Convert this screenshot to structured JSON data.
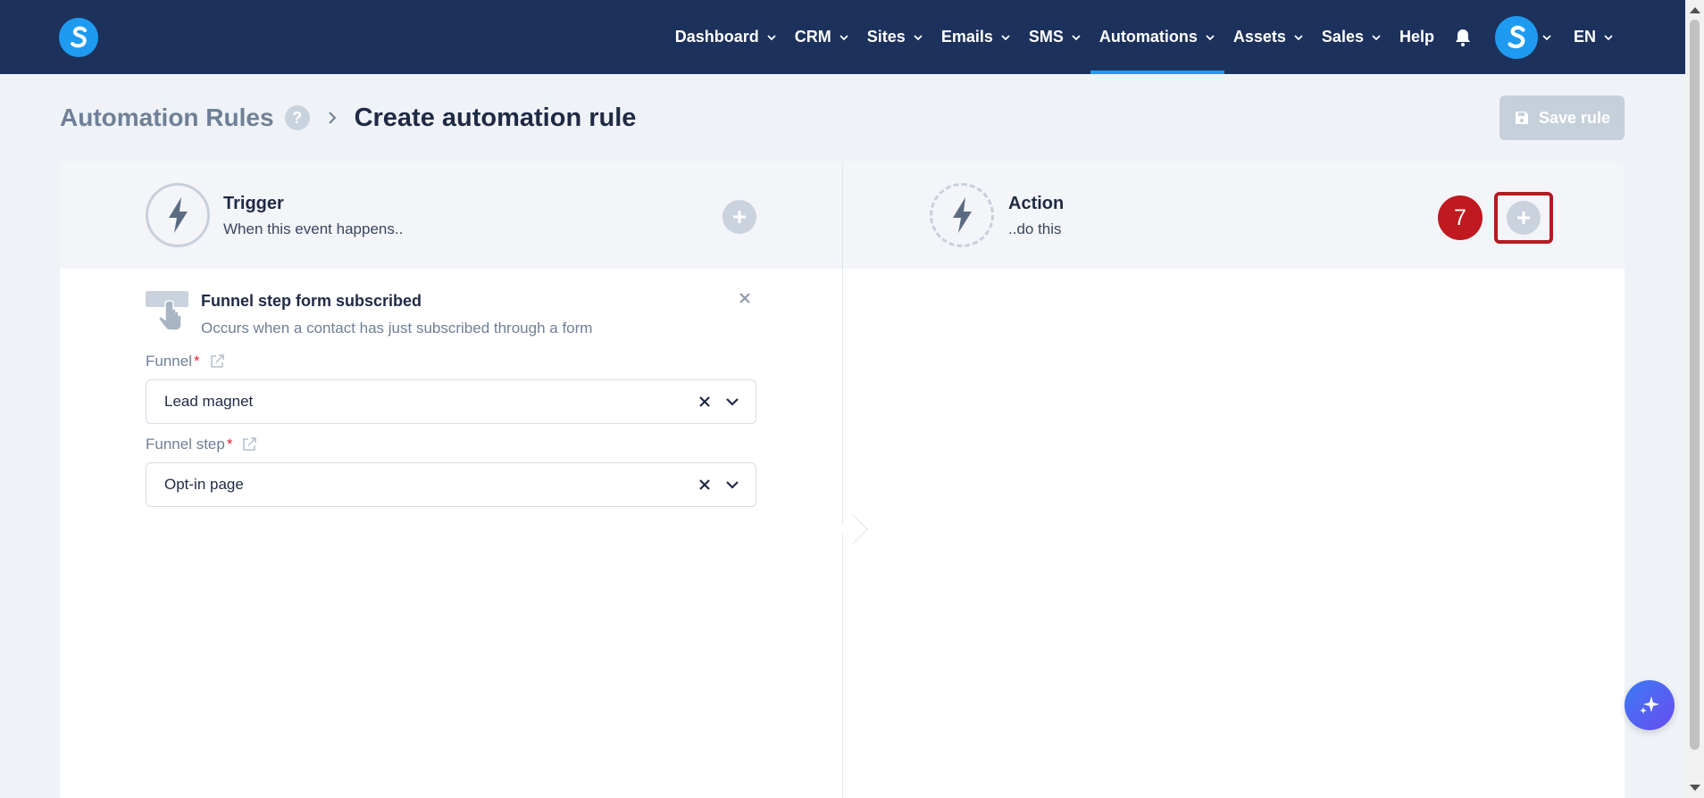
{
  "nav": {
    "items": [
      {
        "label": "Dashboard",
        "has_dropdown": true,
        "active": false
      },
      {
        "label": "CRM",
        "has_dropdown": true,
        "active": false
      },
      {
        "label": "Sites",
        "has_dropdown": true,
        "active": false
      },
      {
        "label": "Emails",
        "has_dropdown": true,
        "active": false
      },
      {
        "label": "SMS",
        "has_dropdown": true,
        "active": false
      },
      {
        "label": "Automations",
        "has_dropdown": true,
        "active": true
      },
      {
        "label": "Assets",
        "has_dropdown": true,
        "active": false
      },
      {
        "label": "Sales",
        "has_dropdown": true,
        "active": false
      },
      {
        "label": "Help",
        "has_dropdown": false,
        "active": false
      }
    ],
    "language": "EN"
  },
  "breadcrumb": {
    "parent": "Automation Rules",
    "help": "?",
    "current": "Create automation rule"
  },
  "toolbar": {
    "save_label": "Save rule"
  },
  "trigger": {
    "title": "Trigger",
    "subtitle": "When this event happens..",
    "event_title": "Funnel step form subscribed",
    "event_desc": "Occurs when a contact has just subscribed through a form",
    "fields": {
      "funnel": {
        "label": "Funnel",
        "required_mark": "*",
        "value": "Lead magnet"
      },
      "funnel_step": {
        "label": "Funnel step",
        "required_mark": "*",
        "value": "Opt-in page"
      }
    }
  },
  "action": {
    "title": "Action",
    "subtitle": "..do this"
  },
  "annotation": {
    "step_number": "7"
  },
  "colors": {
    "nav_bg": "#1c315c",
    "accent": "#1e9bf0",
    "highlight": "#b31b22",
    "page_bg": "#eff3f7"
  },
  "icons": [
    "logo-icon",
    "chevron-down-icon",
    "bell-icon",
    "avatar-icon",
    "help-icon",
    "chevron-right-icon",
    "save-icon",
    "bolt-icon",
    "plus-icon",
    "tap-icon",
    "close-icon",
    "external-link-icon",
    "clear-icon",
    "sparkle-icon"
  ]
}
